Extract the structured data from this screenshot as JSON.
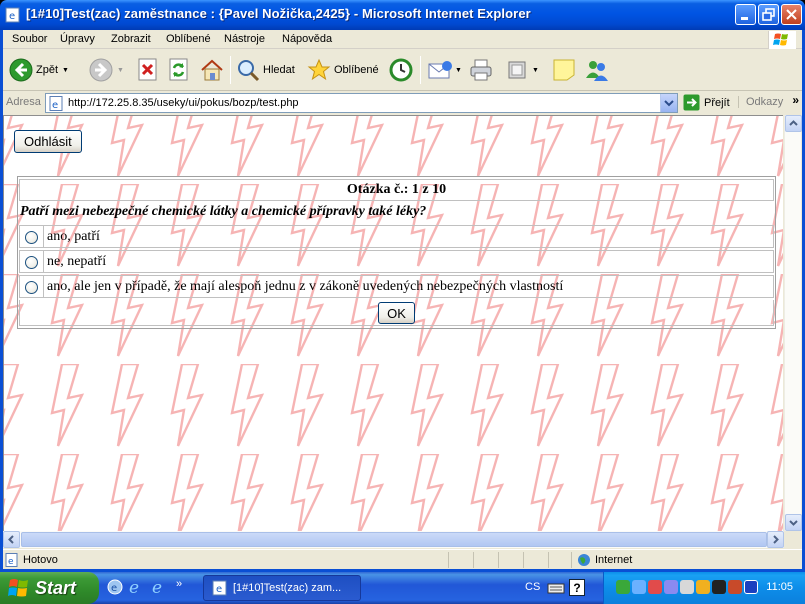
{
  "window": {
    "title": "[1#10]Test(zac) zaměstnance : {Pavel Nožička,2425} - Microsoft Internet Explorer"
  },
  "menu": {
    "items": [
      "Soubor",
      "Úpravy",
      "Zobrazit",
      "Oblíbené",
      "Nástroje",
      "Nápověda"
    ]
  },
  "toolbar": {
    "back_label": "Zpět",
    "search_label": "Hledat",
    "favorites_label": "Oblíbené"
  },
  "address": {
    "label": "Adresa",
    "url": "http://172.25.8.35/useky/ui/pokus/bozp/test.php",
    "go_label": "Přejít",
    "links_label": "Odkazy"
  },
  "page": {
    "logout_label": "Odhlásit",
    "question_header": "Otázka č.: 1 z 10",
    "question_text": "Patří mezi nebezpečné chemické látky a chemické přípravky také léky?",
    "answers": [
      "ano, patří",
      "ne, nepatří",
      "ano, ale jen v případě, že mají alespoň jednu z v zákoně uvedených nebezpečných vlastností"
    ],
    "ok_label": "OK"
  },
  "status": {
    "text": "Hotovo",
    "zone": "Internet"
  },
  "taskbar": {
    "start_label": "Start",
    "task_label": "[1#10]Test(zac) zam...",
    "language": "CS",
    "clock": "11:05"
  },
  "colors": {
    "xp_blue": "#0054e3",
    "background_bolt": "#f4b8b8",
    "start_green": "#3c9a36"
  }
}
